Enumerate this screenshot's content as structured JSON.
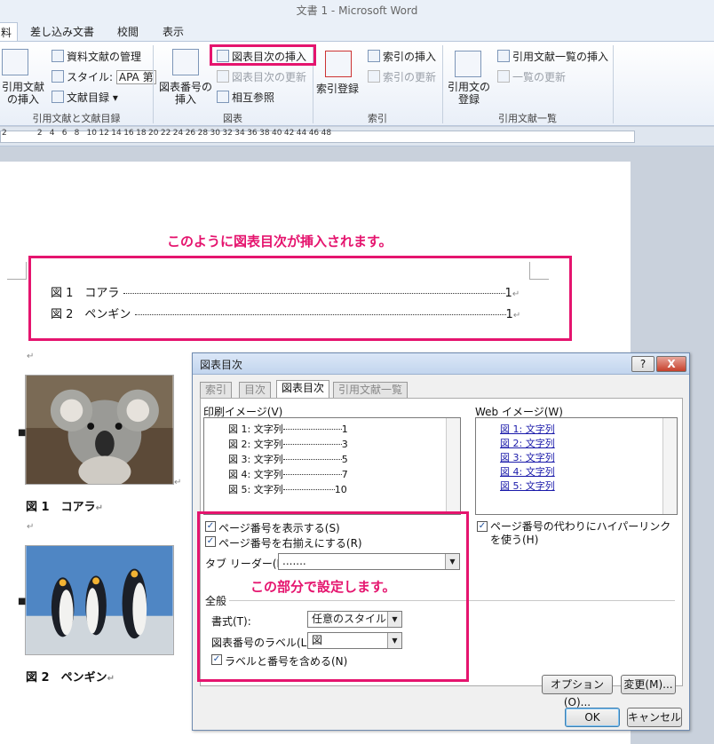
{
  "window": {
    "title": "文書 1 - Microsoft Word"
  },
  "tabs": [
    "料",
    "差し込み文書",
    "校閲",
    "表示"
  ],
  "ribbon": {
    "bib": {
      "manage": "資料文献の管理",
      "style_label": "スタイル:",
      "style_value": "APA 第",
      "bibliography": "文献目録",
      "insert_citation": "引用文献の挿入",
      "group": "引用文献と文献目録"
    },
    "captions": {
      "insert_tof": "図表目次の挿入",
      "update_table": "図表目次の更新",
      "cross_ref": "相互参照",
      "insert_caption": "図表番号の挿入",
      "group": "図表"
    },
    "index": {
      "insert_index": "索引の挿入",
      "update_index": "索引の更新",
      "mark_entry": "索引登録",
      "group": "索引"
    },
    "toa": {
      "insert_toa": "引用文献一覧の挿入",
      "update_toa": "一覧の更新",
      "mark_citation": "引用文の登録",
      "group": "引用文献一覧"
    }
  },
  "ruler": {
    "ticks": [
      "2",
      "2",
      "4",
      "6",
      "8",
      "10",
      "12",
      "14",
      "16",
      "18",
      "20",
      "22",
      "24",
      "26",
      "28",
      "30",
      "32",
      "34",
      "36",
      "38",
      "40",
      "42",
      "44",
      "46",
      "48"
    ]
  },
  "document": {
    "annotation_top": "このように図表目次が挿入されます。",
    "toc": [
      {
        "label": "図 1　コアラ",
        "page": "1"
      },
      {
        "label": "図 2　ペンギン",
        "page": "1"
      }
    ],
    "caption1": "図 1　コアラ",
    "caption2": "図 2　ペンギン"
  },
  "dialog": {
    "title": "図表目次",
    "tabs": [
      "索引",
      "目次",
      "図表目次",
      "引用文献一覧"
    ],
    "print_preview_label": "印刷イメージ(V)",
    "print_items": [
      {
        "label": "図 1: 文字列",
        "page": "1"
      },
      {
        "label": "図 2: 文字列",
        "page": "3"
      },
      {
        "label": "図 3: 文字列",
        "page": "5"
      },
      {
        "label": "図 4: 文字列",
        "page": "7"
      },
      {
        "label": "図 5: 文字列",
        "page": "10"
      }
    ],
    "web_preview_label": "Web イメージ(W)",
    "web_items": [
      "図 1: 文字列",
      "図 2: 文字列",
      "図 3: 文字列",
      "図 4: 文字列",
      "図 5: 文字列"
    ],
    "show_page_numbers": "ページ番号を表示する(S)",
    "right_align": "ページ番号を右揃えにする(R)",
    "tab_leader_label": "タブ リーダー(B):",
    "tab_leader_value": ".......",
    "annotation_settings": "この部分で設定します。",
    "general_label": "全般",
    "format_label": "書式(T):",
    "format_value": "任意のスタイル",
    "caption_label_label": "図表番号のラベル(L):",
    "caption_label_value": "図",
    "include_label": "ラベルと番号を含める(N)",
    "hyperlink": "ページ番号の代わりにハイパーリンクを使う(H)",
    "options_button": "オプション(O)...",
    "modify_button": "変更(M)...",
    "ok_button": "OK",
    "cancel_button": "キャンセル",
    "help_button": "?",
    "close_button": "X"
  },
  "colors": {
    "accent": "#e5146e"
  }
}
